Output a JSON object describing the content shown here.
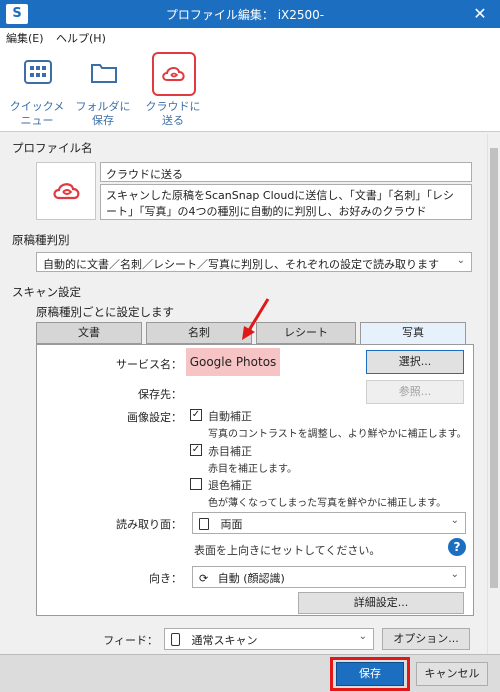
{
  "window": {
    "title": "プロファイル編集： iX2500-",
    "close": "✕",
    "app_logo": "S"
  },
  "menu": [
    {
      "label": "編集(E)"
    },
    {
      "label": "ヘルプ(H)"
    }
  ],
  "toolbar": [
    {
      "label1": "クイックメ",
      "label2": "ニュー",
      "icon": "grid-icon"
    },
    {
      "label1": "フォルダに",
      "label2": "保存",
      "icon": "folder-icon"
    },
    {
      "label1": "クラウドに",
      "label2": "送る",
      "icon": "cloud-icon"
    }
  ],
  "profile": {
    "section_label": "プロファイル名",
    "name_value": "クラウドに送る",
    "description": "スキャンした原稿をScanSnap Cloudに送信し、「文書」「名刺」「レシート」「写真」の4つの種別に自動的に判別し、お好みのクラウド"
  },
  "doc_type": {
    "section_label": "原稿種判別",
    "selected": "自動的に文書／名刺／レシート／写真に判別し、それぞれの設定で読み取ります"
  },
  "scan": {
    "section_label": "スキャン設定",
    "sub_label": "原稿種別ごとに設定します",
    "tabs": [
      "文書",
      "名刺",
      "レシート",
      "写真"
    ],
    "active_tab": "写真"
  },
  "photo": {
    "service_label": "サービス名：",
    "service_value": "Google Photos",
    "select_btn": "選択...",
    "save_label": "保存先：",
    "browse_btn": "参照...",
    "image_label": "画像設定：",
    "options": [
      {
        "label": "自動補正",
        "desc": "写真のコントラストを調整し、より鮮やかに補正します。",
        "checked": true
      },
      {
        "label": "赤目補正",
        "desc": "赤目を補正します。",
        "checked": true
      },
      {
        "label": "退色補正",
        "desc": "色が薄くなってしまった写真を鮮やかに補正します。",
        "checked": false
      }
    ],
    "side_label": "読み取り面：",
    "side_value": "両面",
    "side_hint": "表面を上向きにセットしてください。",
    "help": "?",
    "orient_label": "向き：",
    "orient_value": "自動 (顔認識)",
    "detail_btn": "詳細設定..."
  },
  "feed": {
    "label": "フィード：",
    "value": "通常スキャン",
    "option_btn": "オプション..."
  },
  "footer": {
    "save_btn": "保存",
    "cancel_btn": "キャンセル"
  },
  "colors": {
    "accent": "#1c6fc0",
    "highlight": "#e0393e",
    "service_bg": "#f6c4c4"
  }
}
